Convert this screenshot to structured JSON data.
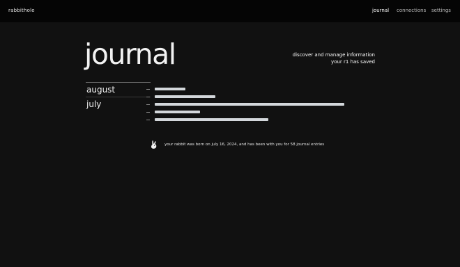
{
  "app": {
    "brand": "rabbithole"
  },
  "nav": {
    "items": [
      {
        "label": "journal",
        "active": true
      },
      {
        "label": "connections",
        "active": false
      },
      {
        "label": "settings",
        "active": false
      }
    ]
  },
  "page": {
    "title": "journal",
    "subtitle_line1": "discover and manage information",
    "subtitle_line2": "your r1 has saved"
  },
  "months": [
    {
      "label": "august",
      "selected": true
    },
    {
      "label": "july",
      "selected": false
    }
  ],
  "entries": [
    {
      "relative_length": 0.16
    },
    {
      "relative_length": 0.32
    },
    {
      "relative_length": 1.0
    },
    {
      "relative_length": 0.24
    },
    {
      "relative_length": 0.6
    }
  ],
  "footer": {
    "icon": "rabbit-icon",
    "note": "your rabbit was born on july 16, 2024, and has been with you for 58 journal entries"
  },
  "colors": {
    "background": "#111111",
    "topbar": "#050505",
    "entry_bar": "#d3d7db"
  }
}
